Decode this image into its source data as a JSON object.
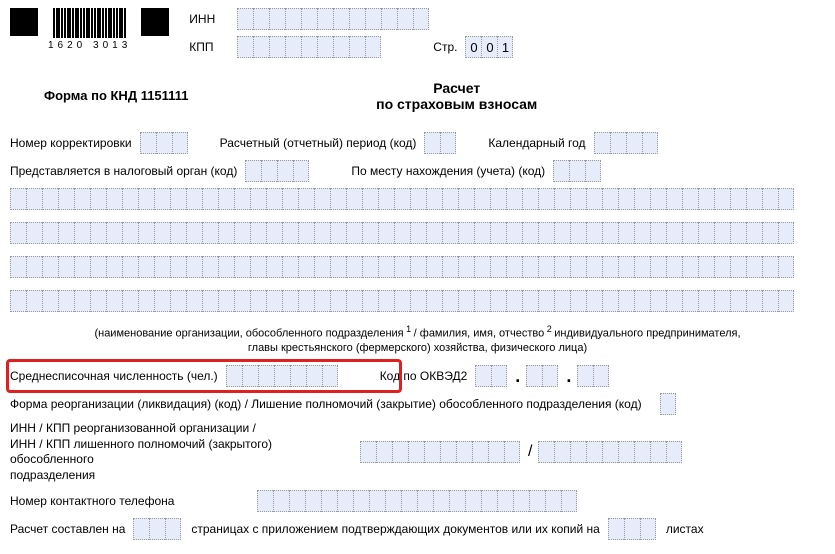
{
  "header": {
    "barcode_numbers": "1620 3013",
    "inn_label": "ИНН",
    "kpp_label": "КПП",
    "page_label": "Стр.",
    "page_value": [
      "0",
      "0",
      "1"
    ]
  },
  "form_code": "Форма по КНД 1151111",
  "title_line1": "Расчет",
  "title_line2": "по страховым взносам",
  "labels": {
    "correction_no": "Номер корректировки",
    "report_period": "Расчетный (отчетный) период (код)",
    "calendar_year": "Календарный год",
    "tax_authority": "Представляется в налоговый орган (код)",
    "location_code": "По месту нахождения (учета) (код)",
    "org_name_note_1": "(наименование организации, обособленного подразделения",
    "org_name_note_2": "/ фамилия, имя, отчество",
    "org_name_note_3": "индивидуального предпринимателя,",
    "org_name_note_4": "главы крестьянского (фермерского) хозяйства, физического лица)",
    "avg_headcount": "Среднесписочная численность (чел.)",
    "okved": "Код по ОКВЭД2",
    "reorg": "Форма реорганизации (ликвидация) (код) / Лишение полномочий (закрытие) обособленного подразделения (код)",
    "reorg_inn_kpp_1": "ИНН / КПП реорганизованной организации /",
    "reorg_inn_kpp_2": "ИНН / КПП лишенного полномочий (закрытого) обособленного",
    "reorg_inn_kpp_3": "подразделения",
    "contact_phone": "Номер контактного телефона",
    "compiled_1": "Расчет составлен на",
    "compiled_2": "страницах с приложением подтверждающих документов или их копий на",
    "compiled_3": "листах"
  },
  "cells": {
    "inn": 12,
    "kpp": 9,
    "page": 3,
    "correction": 3,
    "period": 2,
    "year": 4,
    "tax_auth": 4,
    "location": 3,
    "long": 49,
    "headcount": 7,
    "okved1": 2,
    "okved2": 2,
    "okved3": 2,
    "reorg_code": 1,
    "reorg_inn": 10,
    "reorg_kpp": 9,
    "phone": 20,
    "pages": 3,
    "attach": 3
  }
}
